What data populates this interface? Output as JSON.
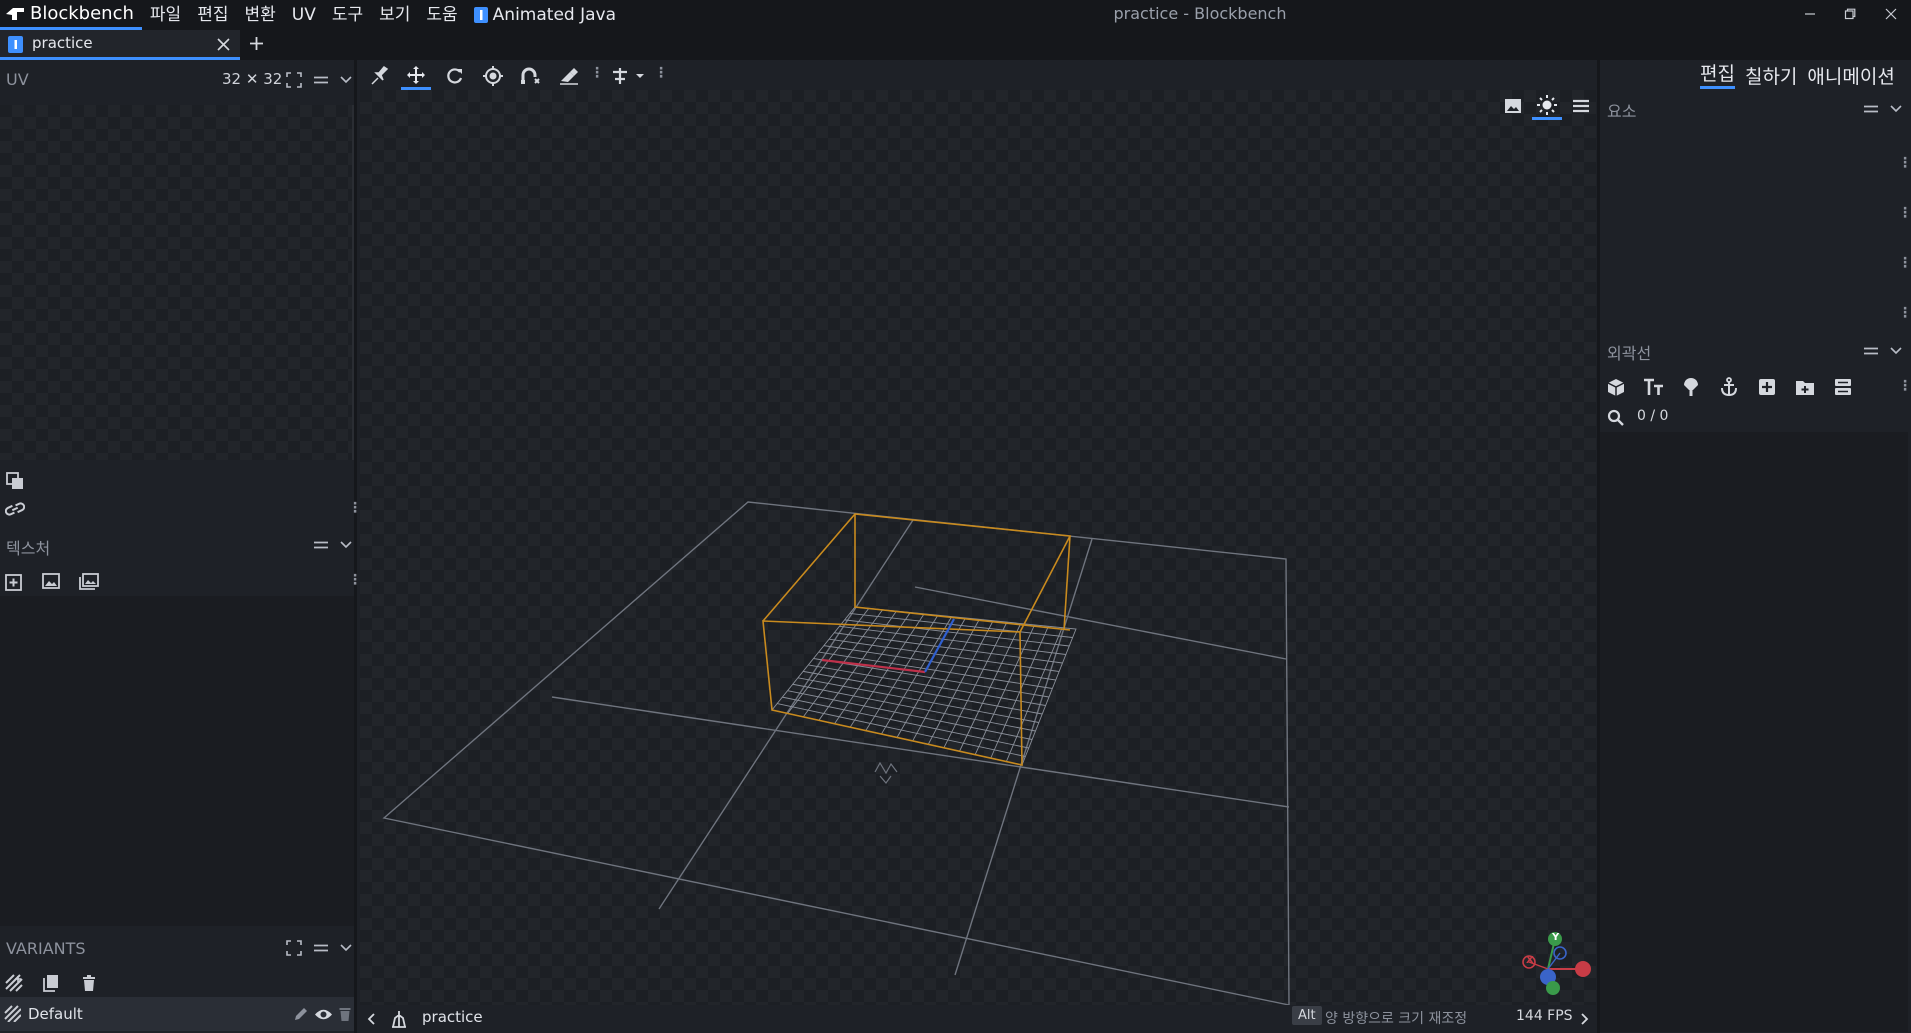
{
  "app": {
    "brand": "Blockbench",
    "window_title": "practice - Blockbench",
    "accent_color": "#3e90ff",
    "menus": [
      "파일",
      "편집",
      "변환",
      "UV",
      "도구",
      "보기",
      "도움"
    ],
    "plugin_menu": "Animated Java"
  },
  "tabs": [
    {
      "label": "practice",
      "icon": "model-icon"
    }
  ],
  "uv_panel": {
    "title": "UV",
    "size_label": "32 ✕ 32"
  },
  "textures_panel": {
    "title": "텍스처"
  },
  "variants_panel": {
    "title": "VARIANTS",
    "items": [
      {
        "label": "Default"
      }
    ]
  },
  "mode_tabs": [
    "편집",
    "칠하기",
    "애니메이션"
  ],
  "elements_panel": {
    "title": "요소"
  },
  "outliner_panel": {
    "title": "외곽선",
    "count": "0 / 0"
  },
  "status": {
    "project": "practice",
    "key_hint": "Alt",
    "hint_text": "양 방향으로 크기 재조정",
    "fps": "144 FPS"
  },
  "gizmo_axes": [
    "Y",
    "X"
  ]
}
